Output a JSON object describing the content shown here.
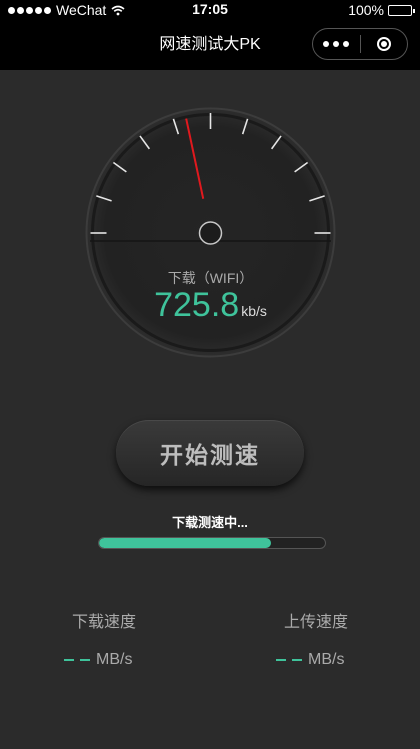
{
  "status_bar": {
    "carrier": "WeChat",
    "time": "17:05",
    "battery_text": "100%",
    "signal_icon": "signal-dots-icon",
    "wifi_icon": "wifi-icon",
    "battery_icon": "battery-icon"
  },
  "navbar": {
    "title": "网速测试大PK",
    "more_icon": "more-dots-icon",
    "close_icon": "close-circle-icon"
  },
  "gauge": {
    "label": "下载（WIFI）",
    "value": "725.8",
    "unit": "kb/s",
    "needle_color": "#e0191e"
  },
  "start_button": {
    "label": "开始测速"
  },
  "progress": {
    "status_text": "下载测速中...",
    "fraction": 0.76,
    "color": "#3fc39b"
  },
  "results": {
    "download_label": "下载速度",
    "upload_label": "上传速度",
    "download_unit": "MB/s",
    "upload_unit": "MB/s"
  },
  "accent_color": "#3fc39b"
}
